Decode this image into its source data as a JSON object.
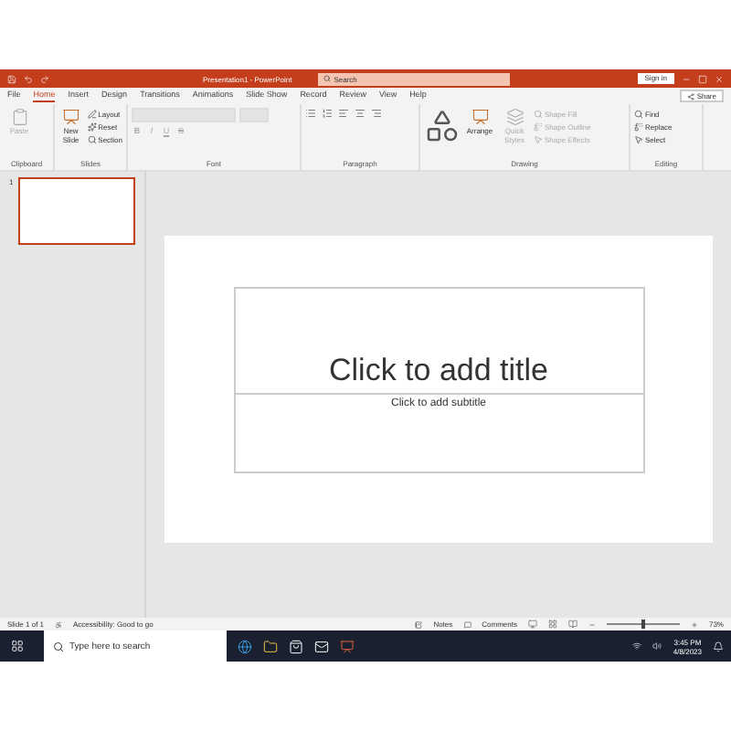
{
  "window": {
    "title": "Presentation1 - PowerPoint",
    "search": {
      "placeholder": "Search"
    },
    "sign_in": "Sign in"
  },
  "tabs": [
    {
      "label": "File",
      "selected": false
    },
    {
      "label": "Home",
      "selected": true
    },
    {
      "label": "Insert",
      "selected": false
    },
    {
      "label": "Design",
      "selected": false
    },
    {
      "label": "Transitions",
      "selected": false
    },
    {
      "label": "Animations",
      "selected": false
    },
    {
      "label": "Slide Show",
      "selected": false
    },
    {
      "label": "Record",
      "selected": false
    },
    {
      "label": "Review",
      "selected": false
    },
    {
      "label": "View",
      "selected": false
    },
    {
      "label": "Help",
      "selected": false
    }
  ],
  "share": "Share",
  "ribbon": [
    {
      "name": "Clipboard",
      "controls": [
        {
          "kind": "large",
          "label": "Paste",
          "disabled": true
        }
      ]
    },
    {
      "name": "Slides",
      "controls": [
        {
          "kind": "large",
          "label": "New Slide",
          "disabled": false
        },
        {
          "kind": "small",
          "label": "Layout",
          "disabled": false
        },
        {
          "kind": "small",
          "label": "Reset",
          "disabled": false
        },
        {
          "kind": "small",
          "label": "Section",
          "disabled": false
        }
      ]
    },
    {
      "name": "Font",
      "controls": [
        {
          "kind": "glyph",
          "label": "B",
          "disabled": true
        },
        {
          "kind": "glyph",
          "label": "I",
          "disabled": true
        },
        {
          "kind": "glyph",
          "label": "U",
          "disabled": true
        },
        {
          "kind": "glyph",
          "label": "S",
          "disabled": true
        }
      ]
    },
    {
      "name": "Paragraph"
    },
    {
      "name": "Drawing",
      "controls": [
        {
          "kind": "shapes"
        },
        {
          "kind": "large",
          "label": "Arrange",
          "disabled": false
        },
        {
          "kind": "large",
          "label": "Quick Styles",
          "disabled": true
        },
        {
          "kind": "small",
          "label": "Shape Fill",
          "disabled": true
        },
        {
          "kind": "small",
          "label": "Shape Outline",
          "disabled": true
        },
        {
          "kind": "small",
          "label": "Shape Effects",
          "disabled": true
        }
      ]
    },
    {
      "name": "Editing",
      "controls": [
        {
          "kind": "small",
          "label": "Find",
          "disabled": false
        },
        {
          "kind": "small",
          "label": "Replace",
          "disabled": false
        },
        {
          "kind": "small",
          "label": "Select",
          "disabled": false
        }
      ]
    }
  ],
  "thumbnails": [
    {
      "number": "1",
      "selected": true
    }
  ],
  "slide": {
    "title_placeholder": "Click to add title",
    "subtitle_placeholder": "Click to add subtitle"
  },
  "status_bar": {
    "slide": "Slide 1 of 1",
    "accessibility": "Accessibility: Good to go",
    "notes": "Notes",
    "comments": "Comments",
    "zoom": "73%",
    "zoom_slider": {
      "level": 0.5
    }
  },
  "taskbar": {
    "search": {
      "placeholder": "Type here to search"
    },
    "time": "3:45 PM",
    "date": "4/8/2023"
  }
}
